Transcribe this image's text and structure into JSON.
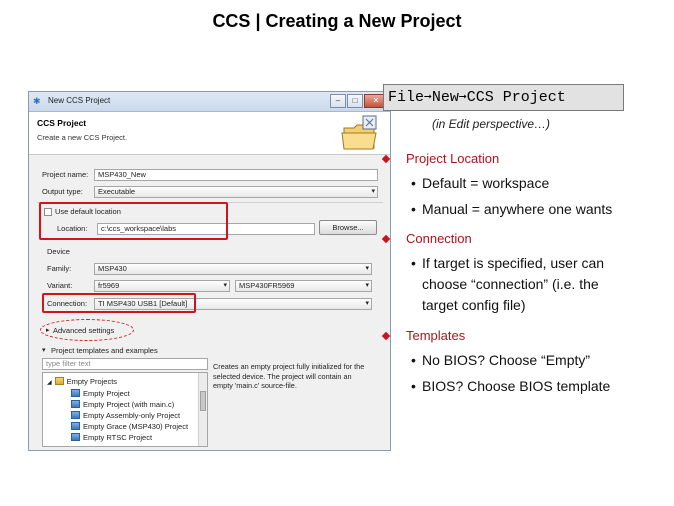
{
  "slide": {
    "title": "CCS | Creating a New Project"
  },
  "dialog": {
    "window_title": "New CCS Project",
    "heading": "CCS Project",
    "subheading": "Create a new CCS Project.",
    "project_name_label": "Project name:",
    "project_name_value": "MSP430_New",
    "output_type_label": "Output type:",
    "output_type_value": "Executable",
    "use_default_location_label": "Use default location",
    "location_label": "Location:",
    "location_value": "c:\\ccs_workspace\\labs",
    "browse_label": "Browse...",
    "device_label": "Device",
    "family_label": "Family:",
    "family_value": "MSP430",
    "variant_label": "Variant:",
    "variant_filter_value": "fr5969",
    "variant_value": "MSP430FR5969",
    "connection_label": "Connection:",
    "connection_value": "TI MSP430 USB1 [Default]",
    "advanced_settings_label": "Advanced settings",
    "templates_label": "Project templates and examples",
    "filter_placeholder": "type filter text",
    "tree_items": [
      "Empty Projects",
      "Empty Project",
      "Empty Project (with main.c)",
      "Empty Assembly-only Project",
      "Empty Grace (MSP430) Project",
      "Empty RTSC Project"
    ],
    "template_description": "Creates an empty project fully initialized for the selected device. The project will contain an empty 'main.c' source-file."
  },
  "notes": {
    "menu_file": "File",
    "menu_new": "New",
    "menu_project": "CCS Project",
    "perspective": "(in Edit perspective…)",
    "section1_title": "Project Location",
    "section1_b1": "Default = workspace",
    "section1_b2": "Manual = anywhere one wants",
    "section2_title": "Connection",
    "section2_b1_l1": "If target is specified, user can",
    "section2_b1_l2": "choose “connection” (i.e. the",
    "section2_b1_l3": "target config file)",
    "section3_title": "Templates",
    "section3_b1": "No BIOS? Choose “Empty”",
    "section3_b2": "BIOS? Choose BIOS template"
  },
  "colors": {
    "accent_red": "#c8141e",
    "section_text": "#a8161d"
  }
}
